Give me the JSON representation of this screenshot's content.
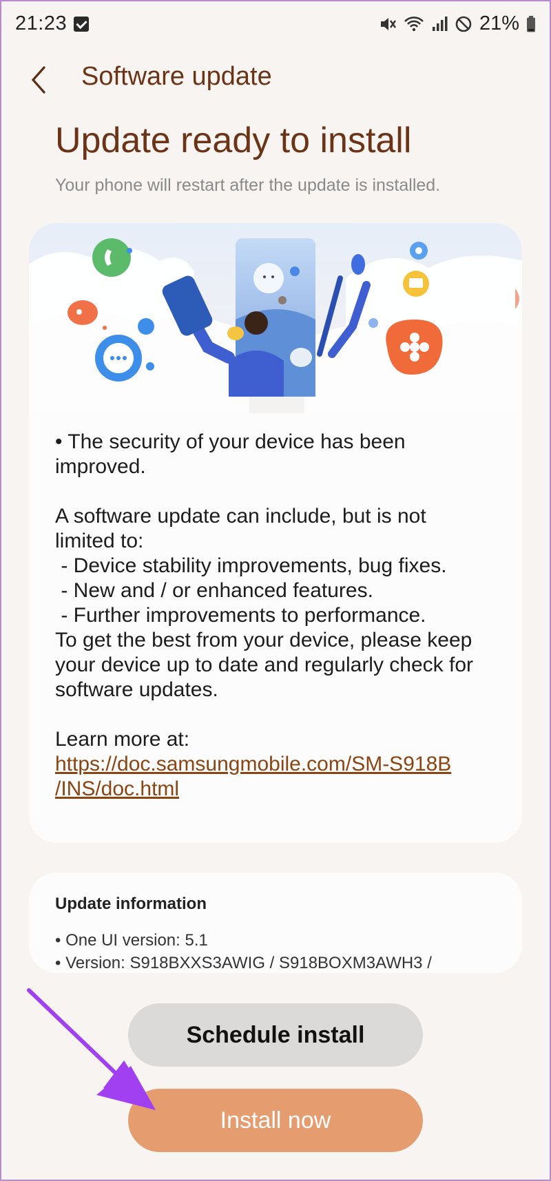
{
  "status_bar": {
    "time": "21:23",
    "battery": "21%"
  },
  "header": {
    "back_label": "Back",
    "title": "Software update"
  },
  "main": {
    "title": "Update ready to install",
    "subtitle": "Your phone will restart after the update is installed."
  },
  "notes": {
    "line1": "• The security of your device has been",
    "line2": "improved.",
    "line3": "A software update can include, but is not",
    "line4": "limited to:",
    "line5": " - Device stability improvements, bug fixes.",
    "line6": " - New and / or enhanced features.",
    "line7": " - Further improvements to performance.",
    "line8": "To get the best from your device, please keep",
    "line9": "your device up to date and regularly check for",
    "line10": "software updates.",
    "learn_more": "Learn more at:",
    "link_part1": "https://doc.samsungmobile.com/SM-S918B",
    "link_part2": "/INS/doc.html"
  },
  "update_info": {
    "title": "Update information",
    "one_ui": "• One UI version: 5.1",
    "version": "• Version: S918BXXS3AWIG / S918BOXM3AWH3 /"
  },
  "buttons": {
    "schedule": "Schedule install",
    "install": "Install now"
  },
  "colors": {
    "accent_brown": "#6b3417",
    "install_orange": "#e59c6e",
    "annotation_arrow": "#a040f0"
  }
}
